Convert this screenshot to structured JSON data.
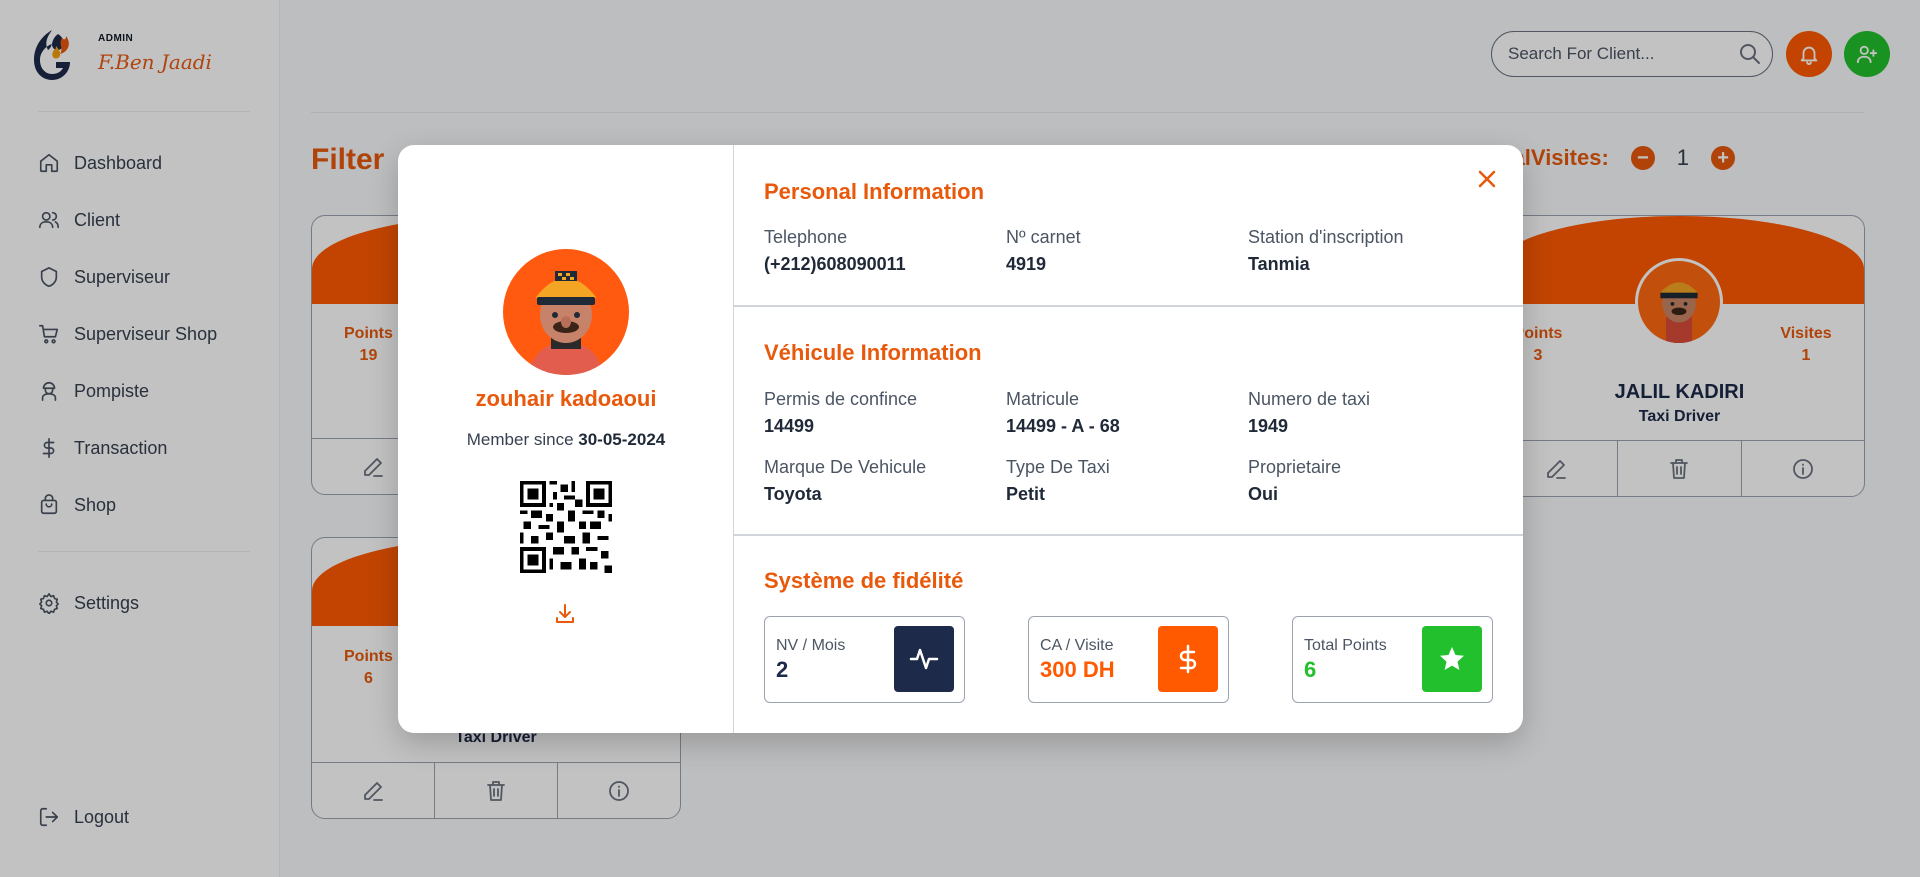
{
  "colors": {
    "accent": "#e8590c",
    "orange_bright": "#ff5a00",
    "navy": "#1e2a4a",
    "green": "#22c02c"
  },
  "brand": {
    "role": "ADMIN",
    "name": "F.Ben Jaadi",
    "logo_icon": "flame-g-logo"
  },
  "sidebar": {
    "items": [
      {
        "label": "Dashboard",
        "icon": "home-icon"
      },
      {
        "label": "Client",
        "icon": "users-icon"
      },
      {
        "label": "Superviseur",
        "icon": "shield-icon"
      },
      {
        "label": "Superviseur Shop",
        "icon": "cart-icon"
      },
      {
        "label": "Pompiste",
        "icon": "worker-icon"
      },
      {
        "label": "Transaction",
        "icon": "dollar-icon"
      },
      {
        "label": "Shop",
        "icon": "bag-icon"
      }
    ],
    "settings": {
      "label": "Settings",
      "icon": "gear-icon"
    },
    "logout": {
      "label": "Logout",
      "icon": "logout-icon"
    }
  },
  "header": {
    "search_placeholder": "Search For Client...",
    "notification_icon": "bell-icon",
    "add_client_icon": "user-plus-icon"
  },
  "filter": {
    "title": "Filter",
    "visits_label": "TotalVisites:",
    "visits_value": "1",
    "minus": "−",
    "plus": "+"
  },
  "cards": [
    {
      "points_label": "Points",
      "points": "19"
    },
    {
      "points_label": "Points",
      "points": "6",
      "role": "Taxi Driver"
    },
    {
      "points_label": "Points",
      "points": "3",
      "visits_label": "Visites",
      "visits": "1",
      "name": "JALIL KADIRI",
      "role": "Taxi Driver"
    }
  ],
  "modal": {
    "name": "zouhair kadoaoui",
    "member_since_label": "Member since",
    "member_since_date": "30-05-2024",
    "personal": {
      "title": "Personal Information",
      "fields": [
        {
          "label": "Telephone",
          "value": "(+212)608090011"
        },
        {
          "label": "Nº carnet",
          "value": "4919"
        },
        {
          "label": "Station d'inscription",
          "value": "Tanmia"
        }
      ]
    },
    "vehicle": {
      "title": "Véhicule Information",
      "fields": [
        {
          "label": "Permis de confince",
          "value": "14499"
        },
        {
          "label": "Matricule",
          "value": "14499 - A - 68"
        },
        {
          "label": "Numero de taxi",
          "value": "1949"
        },
        {
          "label": "Marque De Vehicule",
          "value": "Toyota"
        },
        {
          "label": "Type De Taxi",
          "value": "Petit"
        },
        {
          "label": "Proprietaire",
          "value": "Oui"
        }
      ]
    },
    "loyalty": {
      "title": "Système de fidélité",
      "stats": [
        {
          "label": "NV / Mois",
          "value": "2",
          "icon": "activity-icon",
          "color": "#1e2a4a",
          "icon_bg": "#1e2a4a"
        },
        {
          "label": "CA / Visite",
          "value": "300 DH",
          "icon": "dollar-icon",
          "color": "#ff5a00",
          "icon_bg": "#ff5a00"
        },
        {
          "label": "Total Points",
          "value": "6",
          "icon": "star-icon",
          "color": "#22c02c",
          "icon_bg": "#22c02c"
        }
      ]
    }
  }
}
